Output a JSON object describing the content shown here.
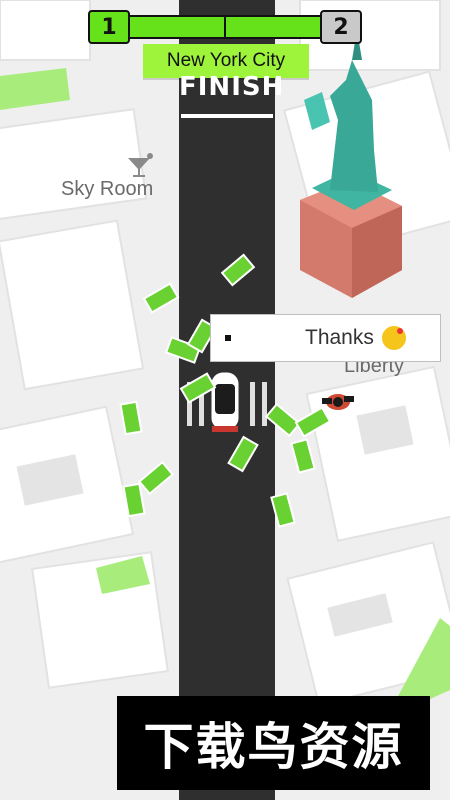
{
  "hud": {
    "current_level": "1",
    "next_level": "2",
    "progress": 1.0,
    "city_name": "New York City",
    "colors": {
      "accent": "#66e21a",
      "city_tag": "#9ef43a"
    }
  },
  "map": {
    "finish_label": "FINISH",
    "labels": {
      "sky_room": "Sky Room",
      "liberty": "Liberty"
    }
  },
  "dialog": {
    "text": "Thanks",
    "emoji_icon": "kissing-face-icon"
  },
  "watermark": {
    "text": "下载鸟资源"
  }
}
